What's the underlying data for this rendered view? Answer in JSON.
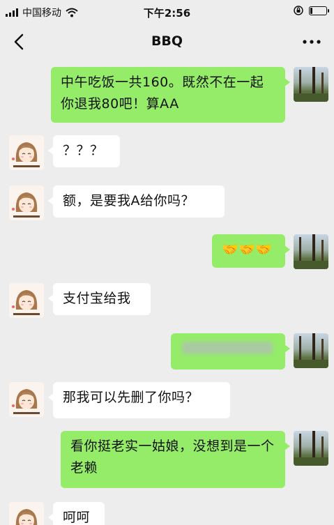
{
  "status_bar": {
    "carrier": "中国移动",
    "time": "下午2:56",
    "battery_level_percent": 15
  },
  "nav": {
    "title": "BBQ",
    "back_icon": "chevron-left-icon",
    "more_icon": "more-dots-icon"
  },
  "messages": [
    {
      "side": "out",
      "text": "中午吃饭一共160。既然不在一起你退我80吧！算AA"
    },
    {
      "side": "in",
      "text": "？？？"
    },
    {
      "side": "in",
      "text": "额，是要我A给你吗？"
    },
    {
      "side": "out",
      "text": "🤝🤝🤝"
    },
    {
      "side": "in",
      "text": "支付宝给我"
    },
    {
      "side": "out",
      "text": "",
      "blurred": true
    },
    {
      "side": "in",
      "text": "那我可以先删了你吗？"
    },
    {
      "side": "out",
      "text": "看你挺老实一姑娘，没想到是一个老赖"
    },
    {
      "side": "in",
      "text": "呵呵"
    }
  ],
  "colors": {
    "background": "#ededed",
    "outgoing_bubble": "#95ec69",
    "incoming_bubble": "#ffffff"
  }
}
